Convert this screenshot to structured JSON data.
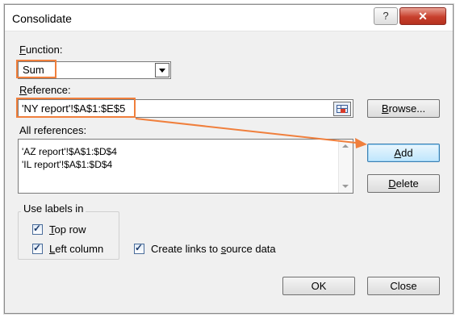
{
  "window": {
    "title": "Consolidate",
    "help_glyph": "?",
    "close_glyph": "✕"
  },
  "function": {
    "label_prefix": "",
    "label_u": "F",
    "label_rest": "unction:",
    "selected": "Sum"
  },
  "reference": {
    "label_u": "R",
    "label_rest": "eference:",
    "value": "'NY report'!$A$1:$E$5"
  },
  "all_references": {
    "label": "All references:",
    "items": [
      "'AZ report'!$A$1:$D$4",
      "'IL report'!$A$1:$D$4"
    ]
  },
  "buttons": {
    "browse_u": "B",
    "browse_rest": "rowse...",
    "add_u": "A",
    "add_rest": "dd",
    "delete_u": "D",
    "delete_rest": "elete",
    "ok": "OK",
    "close": "Close"
  },
  "labels_group": {
    "legend": "Use labels in",
    "top_row_u": "T",
    "top_row_rest": "op row",
    "left_column_u": "L",
    "left_column_rest": "eft column",
    "top_row_checked": true,
    "left_column_checked": true
  },
  "create_links": {
    "label_pre": "Create links to ",
    "label_u": "s",
    "label_rest": "ource data",
    "checked": true
  },
  "colors": {
    "highlight": "#f07f3c",
    "close_button": "#c7402d"
  }
}
